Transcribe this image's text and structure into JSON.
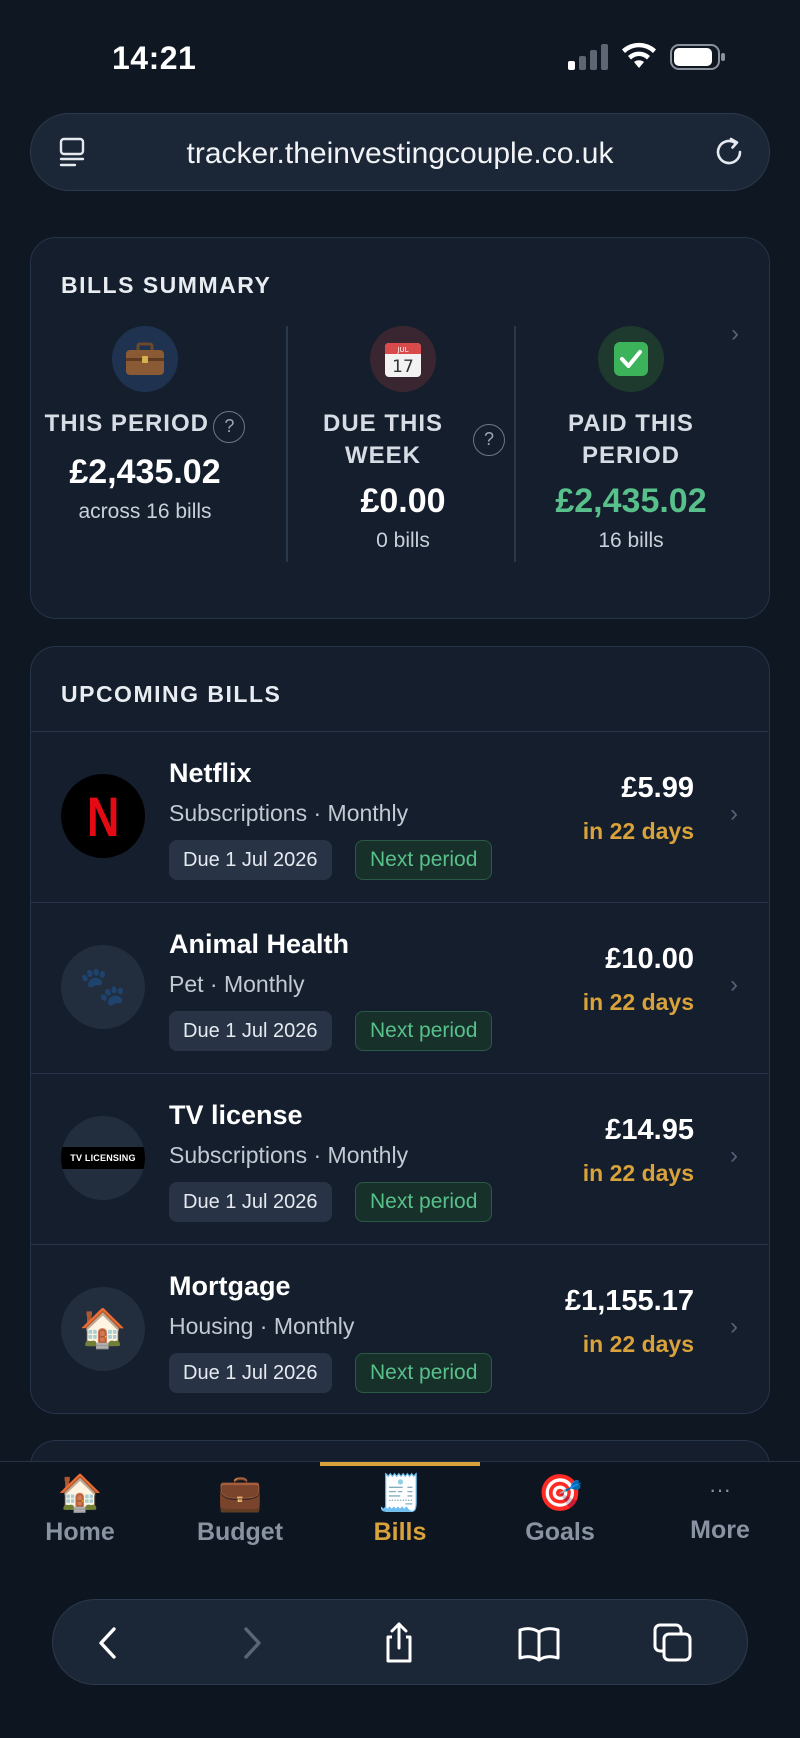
{
  "status_bar": {
    "time": "14:21"
  },
  "browser": {
    "url": "tracker.theinvestingcouple.co.uk"
  },
  "summary": {
    "title": "BILLS SUMMARY",
    "this_period": {
      "label": "THIS PERIOD",
      "amount": "£2,435.02",
      "sub": "across 16 bills",
      "icon": "briefcase-icon"
    },
    "due_this_week": {
      "label_line1": "DUE THIS",
      "label_line2": "WEEK",
      "amount": "£0.00",
      "sub": "0 bills",
      "icon": "calendar-icon"
    },
    "paid_this_period": {
      "label_line1": "PAID THIS",
      "label_line2": "PERIOD",
      "amount": "£2,435.02",
      "sub": "16 bills",
      "icon": "check-icon"
    },
    "help_glyph": "?",
    "chevron": "›",
    "calendar_month": "JUL",
    "calendar_day": "17"
  },
  "upcoming": {
    "title": "UPCOMING BILLS",
    "next_period_label": "Next period",
    "bills": [
      {
        "name": "Netflix",
        "category": "Subscriptions",
        "frequency": "Monthly",
        "due": "Due 1 Jul 2026",
        "amount": "£5.99",
        "when": "in 22 days",
        "logo": "N"
      },
      {
        "name": "Animal Health",
        "category": "Pet",
        "frequency": "Monthly",
        "due": "Due 1 Jul 2026",
        "amount": "£10.00",
        "when": "in 22 days",
        "logo": "🐾"
      },
      {
        "name": "TV license",
        "category": "Subscriptions",
        "frequency": "Monthly",
        "due": "Due 1 Jul 2026",
        "amount": "£14.95",
        "when": "in 22 days",
        "logo": "TV LICENSING"
      },
      {
        "name": "Mortgage",
        "category": "Housing",
        "frequency": "Monthly",
        "due": "Due 1 Jul 2026",
        "amount": "£1,155.17",
        "when": "in 22 days",
        "logo": "🏠"
      }
    ]
  },
  "nav": {
    "items": [
      {
        "label": "Home",
        "icon": "🏠"
      },
      {
        "label": "Budget",
        "icon": "💼"
      },
      {
        "label": "Bills",
        "icon": "🧾"
      },
      {
        "label": "Goals",
        "icon": "🎯"
      },
      {
        "label": "More",
        "icon": "···"
      }
    ],
    "active": "Bills"
  },
  "colors": {
    "accent": "#d9a23a",
    "green": "#58c08a",
    "background": "#0f1722",
    "card": "#141e2c"
  }
}
